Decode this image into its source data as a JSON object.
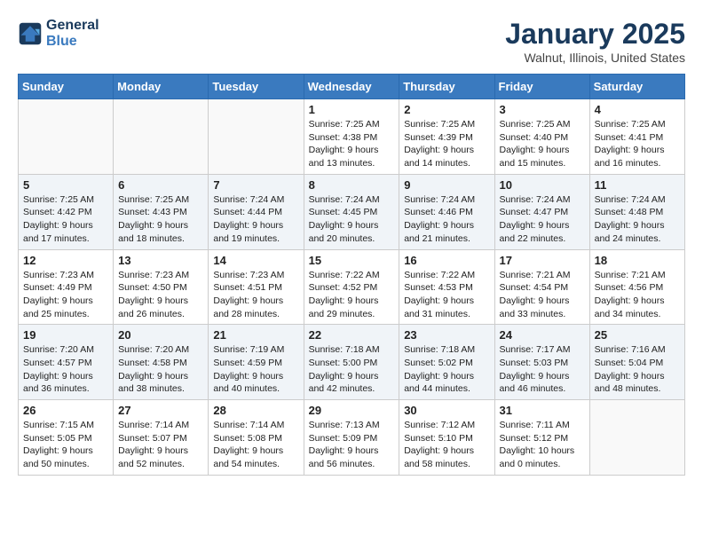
{
  "header": {
    "logo_line1": "General",
    "logo_line2": "Blue",
    "month": "January 2025",
    "location": "Walnut, Illinois, United States"
  },
  "weekdays": [
    "Sunday",
    "Monday",
    "Tuesday",
    "Wednesday",
    "Thursday",
    "Friday",
    "Saturday"
  ],
  "weeks": [
    [
      {
        "day": "",
        "info": ""
      },
      {
        "day": "",
        "info": ""
      },
      {
        "day": "",
        "info": ""
      },
      {
        "day": "1",
        "info": "Sunrise: 7:25 AM\nSunset: 4:38 PM\nDaylight: 9 hours and 13 minutes."
      },
      {
        "day": "2",
        "info": "Sunrise: 7:25 AM\nSunset: 4:39 PM\nDaylight: 9 hours and 14 minutes."
      },
      {
        "day": "3",
        "info": "Sunrise: 7:25 AM\nSunset: 4:40 PM\nDaylight: 9 hours and 15 minutes."
      },
      {
        "day": "4",
        "info": "Sunrise: 7:25 AM\nSunset: 4:41 PM\nDaylight: 9 hours and 16 minutes."
      }
    ],
    [
      {
        "day": "5",
        "info": "Sunrise: 7:25 AM\nSunset: 4:42 PM\nDaylight: 9 hours and 17 minutes."
      },
      {
        "day": "6",
        "info": "Sunrise: 7:25 AM\nSunset: 4:43 PM\nDaylight: 9 hours and 18 minutes."
      },
      {
        "day": "7",
        "info": "Sunrise: 7:24 AM\nSunset: 4:44 PM\nDaylight: 9 hours and 19 minutes."
      },
      {
        "day": "8",
        "info": "Sunrise: 7:24 AM\nSunset: 4:45 PM\nDaylight: 9 hours and 20 minutes."
      },
      {
        "day": "9",
        "info": "Sunrise: 7:24 AM\nSunset: 4:46 PM\nDaylight: 9 hours and 21 minutes."
      },
      {
        "day": "10",
        "info": "Sunrise: 7:24 AM\nSunset: 4:47 PM\nDaylight: 9 hours and 22 minutes."
      },
      {
        "day": "11",
        "info": "Sunrise: 7:24 AM\nSunset: 4:48 PM\nDaylight: 9 hours and 24 minutes."
      }
    ],
    [
      {
        "day": "12",
        "info": "Sunrise: 7:23 AM\nSunset: 4:49 PM\nDaylight: 9 hours and 25 minutes."
      },
      {
        "day": "13",
        "info": "Sunrise: 7:23 AM\nSunset: 4:50 PM\nDaylight: 9 hours and 26 minutes."
      },
      {
        "day": "14",
        "info": "Sunrise: 7:23 AM\nSunset: 4:51 PM\nDaylight: 9 hours and 28 minutes."
      },
      {
        "day": "15",
        "info": "Sunrise: 7:22 AM\nSunset: 4:52 PM\nDaylight: 9 hours and 29 minutes."
      },
      {
        "day": "16",
        "info": "Sunrise: 7:22 AM\nSunset: 4:53 PM\nDaylight: 9 hours and 31 minutes."
      },
      {
        "day": "17",
        "info": "Sunrise: 7:21 AM\nSunset: 4:54 PM\nDaylight: 9 hours and 33 minutes."
      },
      {
        "day": "18",
        "info": "Sunrise: 7:21 AM\nSunset: 4:56 PM\nDaylight: 9 hours and 34 minutes."
      }
    ],
    [
      {
        "day": "19",
        "info": "Sunrise: 7:20 AM\nSunset: 4:57 PM\nDaylight: 9 hours and 36 minutes."
      },
      {
        "day": "20",
        "info": "Sunrise: 7:20 AM\nSunset: 4:58 PM\nDaylight: 9 hours and 38 minutes."
      },
      {
        "day": "21",
        "info": "Sunrise: 7:19 AM\nSunset: 4:59 PM\nDaylight: 9 hours and 40 minutes."
      },
      {
        "day": "22",
        "info": "Sunrise: 7:18 AM\nSunset: 5:00 PM\nDaylight: 9 hours and 42 minutes."
      },
      {
        "day": "23",
        "info": "Sunrise: 7:18 AM\nSunset: 5:02 PM\nDaylight: 9 hours and 44 minutes."
      },
      {
        "day": "24",
        "info": "Sunrise: 7:17 AM\nSunset: 5:03 PM\nDaylight: 9 hours and 46 minutes."
      },
      {
        "day": "25",
        "info": "Sunrise: 7:16 AM\nSunset: 5:04 PM\nDaylight: 9 hours and 48 minutes."
      }
    ],
    [
      {
        "day": "26",
        "info": "Sunrise: 7:15 AM\nSunset: 5:05 PM\nDaylight: 9 hours and 50 minutes."
      },
      {
        "day": "27",
        "info": "Sunrise: 7:14 AM\nSunset: 5:07 PM\nDaylight: 9 hours and 52 minutes."
      },
      {
        "day": "28",
        "info": "Sunrise: 7:14 AM\nSunset: 5:08 PM\nDaylight: 9 hours and 54 minutes."
      },
      {
        "day": "29",
        "info": "Sunrise: 7:13 AM\nSunset: 5:09 PM\nDaylight: 9 hours and 56 minutes."
      },
      {
        "day": "30",
        "info": "Sunrise: 7:12 AM\nSunset: 5:10 PM\nDaylight: 9 hours and 58 minutes."
      },
      {
        "day": "31",
        "info": "Sunrise: 7:11 AM\nSunset: 5:12 PM\nDaylight: 10 hours and 0 minutes."
      },
      {
        "day": "",
        "info": ""
      }
    ]
  ]
}
